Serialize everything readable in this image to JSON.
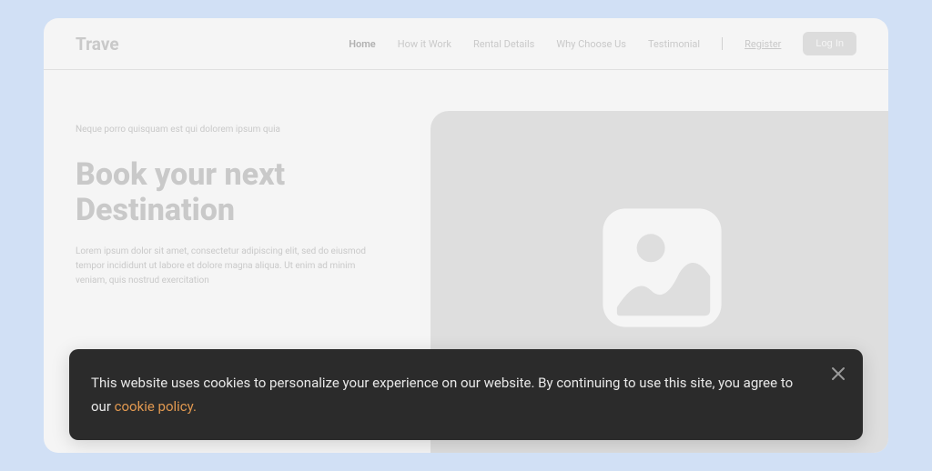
{
  "header": {
    "logo": "Trave",
    "nav": {
      "home": "Home",
      "how_it_work": "How it Work",
      "rental_details": "Rental Details",
      "why_choose_us": "Why Choose Us",
      "testimonial": "Testimonial"
    },
    "register": "Register",
    "login": "Log In"
  },
  "hero": {
    "eyebrow": "Neque porro quisquam est qui dolorem ipsum quia",
    "headline_line1": "Book your next",
    "headline_line2": "Destination",
    "description": "Lorem ipsum dolor sit amet, consectetur adipiscing elit, sed do eiusmod tempor incididunt ut labore et dolore magna aliqua. Ut enim ad minim veniam, quis nostrud exercitation"
  },
  "cookie": {
    "text_part1": "This website uses cookies to personalize your experience on our website. By continuing to use this site, you agree to our ",
    "link": "cookie policy.",
    "colors": {
      "bg": "#2b2b2b",
      "link": "#e09850"
    }
  }
}
